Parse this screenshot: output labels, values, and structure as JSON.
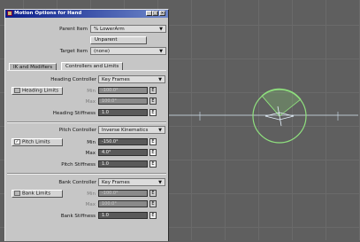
{
  "window": {
    "title": "Motion Options for Hand",
    "minimize_glyph": "_",
    "maximize_glyph": "□",
    "close_glyph": "×"
  },
  "parent_item": {
    "label": "Parent Item",
    "value": "% LowerArm"
  },
  "unparent_label": "Unparent",
  "target_item": {
    "label": "Target Item",
    "value": "(none)"
  },
  "tabs": [
    {
      "label": "IK and Modifiers",
      "active": false
    },
    {
      "label": "Controllers and Limits",
      "active": true
    }
  ],
  "heading": {
    "controller_label": "Heading Controller",
    "controller_value": "Key Frames",
    "limits_label": "Heading Limits",
    "limits_toggle": "",
    "min_label": "Min",
    "min_value": "-100.0°",
    "max_label": "Max",
    "max_value": "100.0°",
    "stiffness_label": "Heading Stiffness",
    "stiffness_value": "1.0"
  },
  "pitch": {
    "controller_label": "Pitch Controller",
    "controller_value": "Inverse Kinematics",
    "limits_label": "Pitch Limits",
    "limits_toggle": "✓",
    "min_label": "Min",
    "min_value": "-150.0°",
    "max_label": "Max",
    "max_value": "4.0°",
    "stiffness_label": "Pitch Stiffness",
    "stiffness_value": "1.0"
  },
  "bank": {
    "controller_label": "Bank Controller",
    "controller_value": "Key Frames",
    "limits_label": "Bank Limits",
    "limits_toggle": "",
    "min_label": "Min",
    "min_value": "-100.0°",
    "max_label": "Max",
    "max_value": "100.0°",
    "stiffness_label": "Bank Stiffness",
    "stiffness_value": "1.0"
  },
  "icons": {
    "dropdown_arrow": "▼",
    "envelope_button": "E"
  },
  "colors": {
    "titlebar_start": "#0a1e8a",
    "titlebar_end": "#6d86c8",
    "viewport_bg": "#5f5f5f",
    "limit_circle": "#7fe07a",
    "bone_line": "#e8f4ff"
  }
}
